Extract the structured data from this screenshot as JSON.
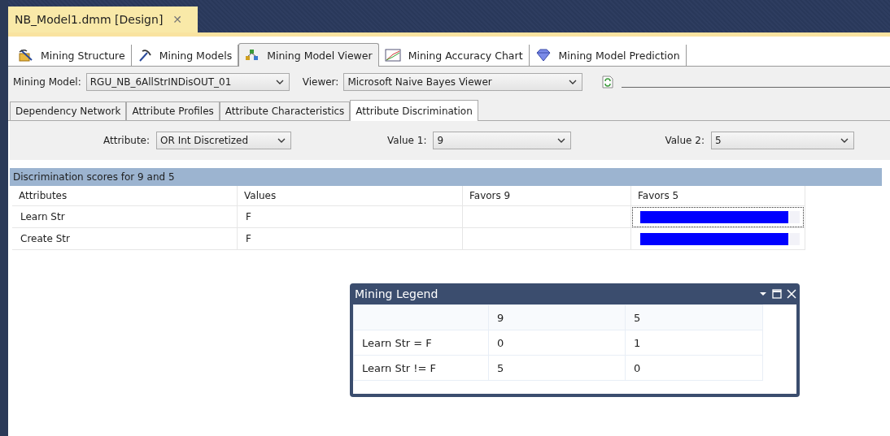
{
  "document_tab": {
    "title": "NB_Model1.dmm [Design]",
    "close": "✕"
  },
  "designer_tabs": [
    {
      "label": "Mining Structure",
      "selected": false
    },
    {
      "label": "Mining Models",
      "selected": false
    },
    {
      "label": "Mining Model Viewer",
      "selected": true
    },
    {
      "label": "Mining Accuracy Chart",
      "selected": false
    },
    {
      "label": "Mining Model Prediction",
      "selected": false
    }
  ],
  "model_bar": {
    "model_label": "Mining Model:",
    "model_value": "RGU_NB_6AllStrINDisOUT_01",
    "viewer_label": "Viewer:",
    "viewer_value": "Microsoft Naive Bayes Viewer"
  },
  "viewer_tabs": [
    {
      "label": "Dependency Network",
      "selected": false
    },
    {
      "label": "Attribute Profiles",
      "selected": false
    },
    {
      "label": "Attribute Characteristics",
      "selected": false
    },
    {
      "label": "Attribute Discrimination",
      "selected": true
    }
  ],
  "filters": [
    {
      "label": "Attribute:",
      "value": "OR Int Discretized"
    },
    {
      "label": "Value 1:",
      "value": "9"
    },
    {
      "label": "Value 2:",
      "value": "5"
    }
  ],
  "scores": {
    "title": "Discrimination scores for 9 and 5",
    "columns": [
      "Attributes",
      "Values",
      "Favors 9",
      "Favors 5"
    ],
    "rows": [
      {
        "attribute": "Learn Str",
        "value": "F",
        "level": 0.93,
        "focused": true
      },
      {
        "attribute": "Create Str",
        "value": "F",
        "level": 0.93,
        "focused": false
      }
    ]
  },
  "legend": {
    "title": "Mining Legend",
    "columns": [
      "9",
      "5"
    ],
    "rows": [
      {
        "label": "Learn Str = F",
        "values": [
          "0",
          "1"
        ]
      },
      {
        "label": "Learn Str != F",
        "values": [
          "5",
          "0"
        ]
      }
    ]
  }
}
